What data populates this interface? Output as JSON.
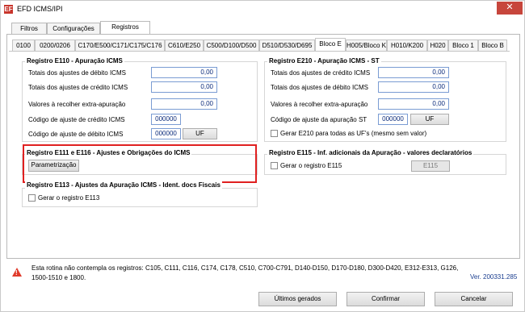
{
  "window": {
    "title": "EFD ICMS/IPI",
    "app_icon": "EF",
    "close_icon": "✕"
  },
  "top_tabs": [
    {
      "label": "Filtros"
    },
    {
      "label": "Configurações"
    },
    {
      "label": "Registros"
    }
  ],
  "sub_tabs": [
    {
      "label": "0100"
    },
    {
      "label": "0200/0206"
    },
    {
      "label": "C170/E500/C171/C175/C176"
    },
    {
      "label": "C610/E250"
    },
    {
      "label": "C500/D100/D500"
    },
    {
      "label": "D510/D530/D695"
    },
    {
      "label": "Bloco E"
    },
    {
      "label": "H005/Bloco K"
    },
    {
      "label": "H010/K200"
    },
    {
      "label": "H020"
    },
    {
      "label": "Bloco 1"
    },
    {
      "label": "Bloco B"
    }
  ],
  "e110": {
    "title": "Registro E110  - Apuração ICMS",
    "rows": [
      {
        "label": "Totais dos ajustes de débito ICMS",
        "value": "0,00"
      },
      {
        "label": "Totais dos ajustes de crédito ICMS",
        "value": "0,00"
      },
      {
        "label": "Valores à recolher extra-apuração",
        "value": "0,00"
      }
    ],
    "codigo_credito_label": "Código de ajuste de crédito ICMS",
    "codigo_credito_value": "000000",
    "codigo_debito_label": "Código de ajuste de débito ICMS",
    "codigo_debito_value": "000000",
    "uf_label": "UF"
  },
  "e210": {
    "title": "Registro E210  - Apuração ICMS - ST",
    "rows": [
      {
        "label": "Totais dos ajustes de crédito ICMS",
        "value": "0,00"
      },
      {
        "label": "Totais dos ajustes de débito ICMS",
        "value": "0,00"
      },
      {
        "label": "Valores à recolher extra-apuração",
        "value": "0,00"
      }
    ],
    "codigo_label": "Código de ajuste da apuração ST",
    "codigo_value": "000000",
    "uf_label": "UF",
    "checkbox_label": "Gerar E210 para todas as UF's (mesmo sem valor)"
  },
  "e111": {
    "title": "Registro E111 e E116 - Ajustes e Obrigações do ICMS",
    "button_label": "Parametrização"
  },
  "e113": {
    "title": "Registro E113 - Ajustes da Apuração ICMS - Ident. docs Fiscais",
    "checkbox_label": "Gerar o registro E113"
  },
  "e115": {
    "title": "Registro E115 - Inf. adicionais da Apuração - valores declaratórios",
    "checkbox_label": "Gerar o registro E115",
    "button_label": "E115"
  },
  "footer": {
    "warning_icon_mark": "!",
    "message": "Esta rotina não contempla os registros: C105, C111, C116, C174, C178, C510, C700-C791, D140-D150, D170-D180, D300-D420, E312-E313, G126, 1500-1510 e 1800.",
    "version": "Ver. 200331.285"
  },
  "buttons": {
    "ultimos": "Últimos gerados",
    "confirmar": "Confirmar",
    "cancelar": "Cancelar"
  }
}
